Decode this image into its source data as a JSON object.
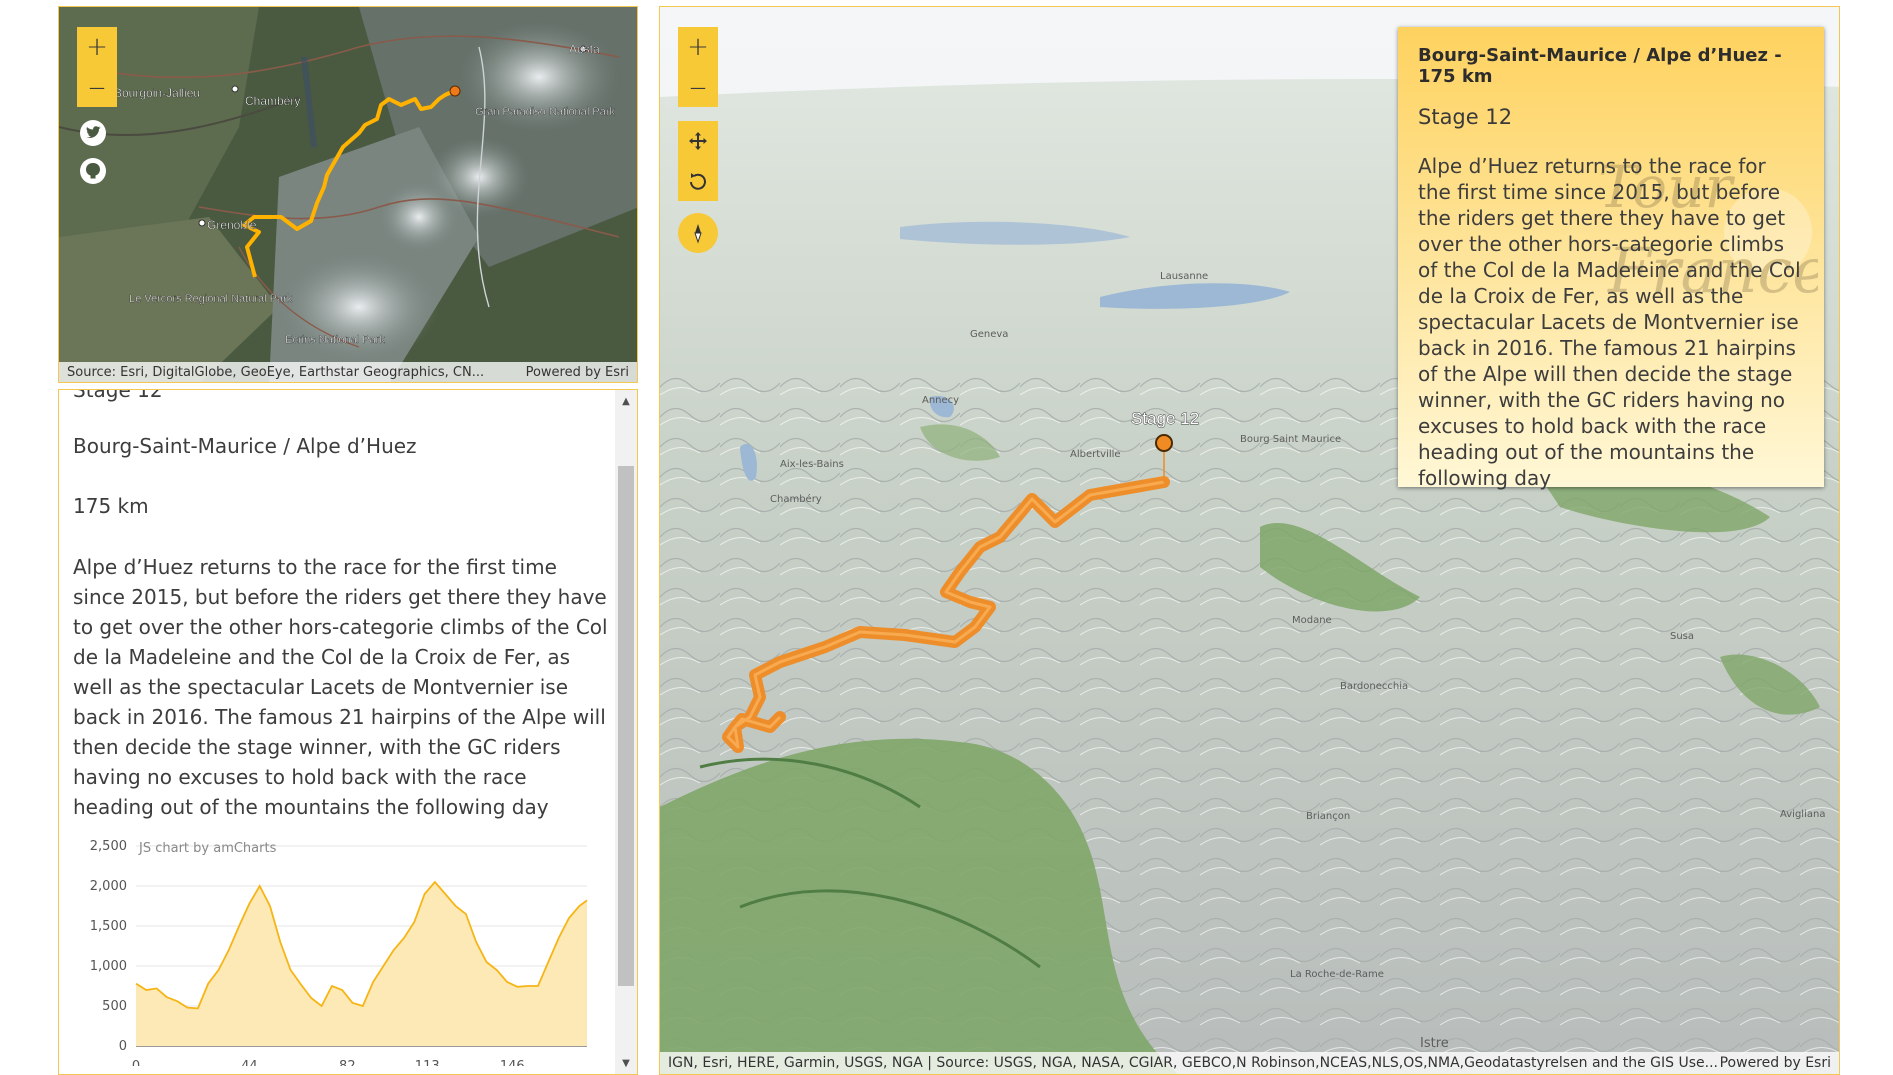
{
  "overview_map": {
    "zoom_in_label": "+",
    "zoom_out_label": "—",
    "place_labels": [
      "Bourgoin-Jallieu",
      "Chambéry",
      "Aosta",
      "Gran Paradiso National Park",
      "Grenoble",
      "Le Vercors Regional Natural Park",
      "Ecrins National Park"
    ],
    "attribution": "Source: Esri, DigitalGlobe, GeoEye, Earthstar Geographics, CN...",
    "powered_by": "Powered by Esri",
    "social_icons": [
      "twitter-icon",
      "github-icon"
    ]
  },
  "details": {
    "partial_heading": "Stage 12",
    "route": "Bourg-Saint-Maurice / Alpe d’Huez",
    "distance": "175 km",
    "description": "Alpe d’Huez returns to the race for the first time since 2015, but before the riders get there they have to get over the other hors-categorie climbs of the Col de la Madeleine and the Col de la Croix de Fer, as well as the spectacular Lacets de Montvernier ise back in 2016. The famous 21 hairpins of the Alpe will then decide the stage winner, with the GC riders having no excuses to hold back with the race heading out of the mountains the following day"
  },
  "chart_data": {
    "type": "area",
    "watermark": "JS chart by amCharts",
    "y_ticks": [
      "2,500",
      "2,000",
      "1,500",
      "1,000",
      "500",
      "0"
    ],
    "x_ticks": [
      "0",
      "44",
      "82",
      "113",
      "146"
    ],
    "ylim": [
      0,
      2500
    ],
    "xlim": [
      0,
      175
    ],
    "x": [
      0,
      4,
      8,
      12,
      16,
      20,
      24,
      28,
      32,
      36,
      40,
      44,
      48,
      52,
      56,
      60,
      64,
      68,
      72,
      76,
      80,
      84,
      88,
      92,
      96,
      100,
      104,
      108,
      112,
      116,
      120,
      124,
      128,
      132,
      136,
      140,
      144,
      148,
      152,
      156,
      160,
      164,
      168,
      172,
      175
    ],
    "y": [
      780,
      700,
      720,
      610,
      560,
      480,
      470,
      780,
      950,
      1200,
      1500,
      1780,
      2000,
      1750,
      1300,
      950,
      770,
      600,
      500,
      750,
      700,
      540,
      500,
      800,
      1000,
      1200,
      1350,
      1550,
      1900,
      2050,
      1900,
      1750,
      1650,
      1300,
      1050,
      950,
      800,
      740,
      750,
      750,
      1050,
      1350,
      1600,
      1750,
      1820
    ],
    "line_color": "#f5b516",
    "fill_color": "#fde9b5"
  },
  "scene": {
    "zoom_in_label": "+",
    "zoom_out_label": "—",
    "pan_icon": "move-icon",
    "rotate_icon": "rotate-icon",
    "compass_icon": "compass-icon",
    "stage_label": "Stage 12",
    "place_labels": [
      "Lausanne",
      "Geneva",
      "Annecy",
      "Aix-les-Bains",
      "Chambéry",
      "Albertville",
      "Bourg Saint Maurice",
      "Modane",
      "Bardonecchia",
      "Susa",
      "Briançon",
      "La Roche-de-Rame",
      "Avigliana",
      "Istre"
    ],
    "attribution": "IGN, Esri, HERE, Garmin, USGS, NGA | Source: USGS, NGA, NASA, CGIAR, GEBCO,N Robinson,NCEAS,NLS,OS,NMA,Geodatastyrelsen and the GIS Use...",
    "powered_by": "Powered by Esri",
    "route_color": "#f08a23"
  },
  "popup": {
    "title": "Bourg-Saint-Maurice / Alpe d’Huez - 175 km",
    "subtitle": "Stage 12",
    "body": "Alpe d’Huez returns to the race for the first time since 2015, but before the riders get there they have to get over the other hors-categorie climbs of the Col de la Madeleine and the Col de la Croix de Fer, as well as the spectacular Lacets de Montvernier ise back in 2016. The famous 21 hairpins of the Alpe will then decide the stage winner, with the GC riders having no excuses to hold back with the race heading out of the mountains the following day",
    "watermark_logo": "Le Tour de France"
  }
}
